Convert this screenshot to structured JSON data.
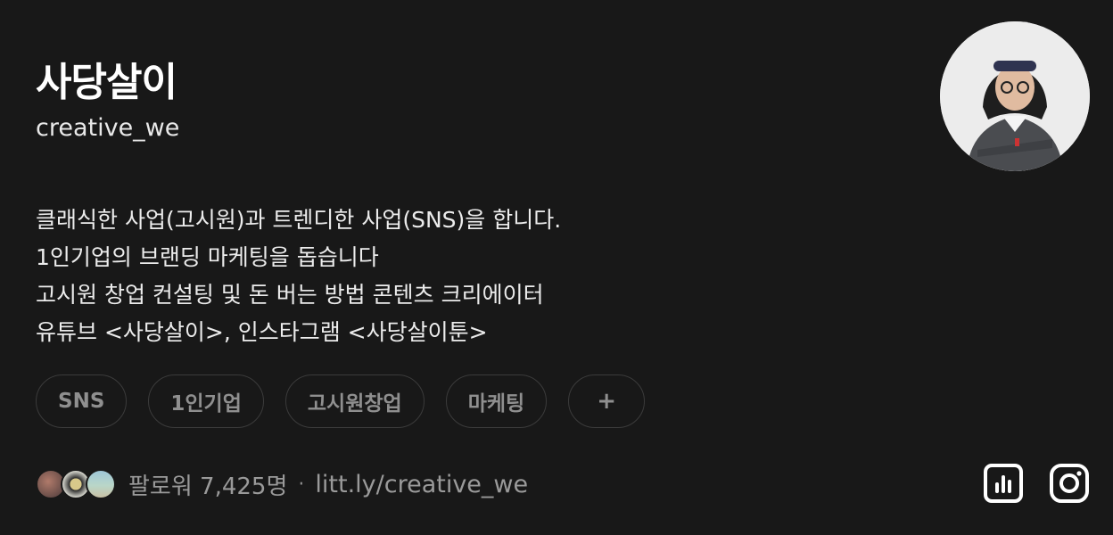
{
  "profile": {
    "name": "사당살이",
    "username": "creative_we",
    "bio": [
      "클래식한 사업(고시원)과 트렌디한 사업(SNS)을 합니다.",
      "1인기업의 브랜딩 마케팅을 돕습니다",
      "고시원 창업 컨설팅 및 돈 버는 방법 콘텐츠 크리에이터",
      "유튜브 <사당살이>, 인스타그램 <사당살이툰>"
    ]
  },
  "tags": [
    "SNS",
    "1인기업",
    "고시원창업",
    "마케팅",
    "+"
  ],
  "footer": {
    "followers_label": "팔로워 7,425명",
    "separator": "·",
    "link": "litt.ly/creative_we"
  },
  "icons": {
    "stats": "bar-chart-icon",
    "instagram": "instagram-icon"
  },
  "colors": {
    "background": "#181818",
    "text_primary": "#ffffff",
    "text_muted": "#9a9a9a",
    "tag_border": "#3b3b3b"
  }
}
